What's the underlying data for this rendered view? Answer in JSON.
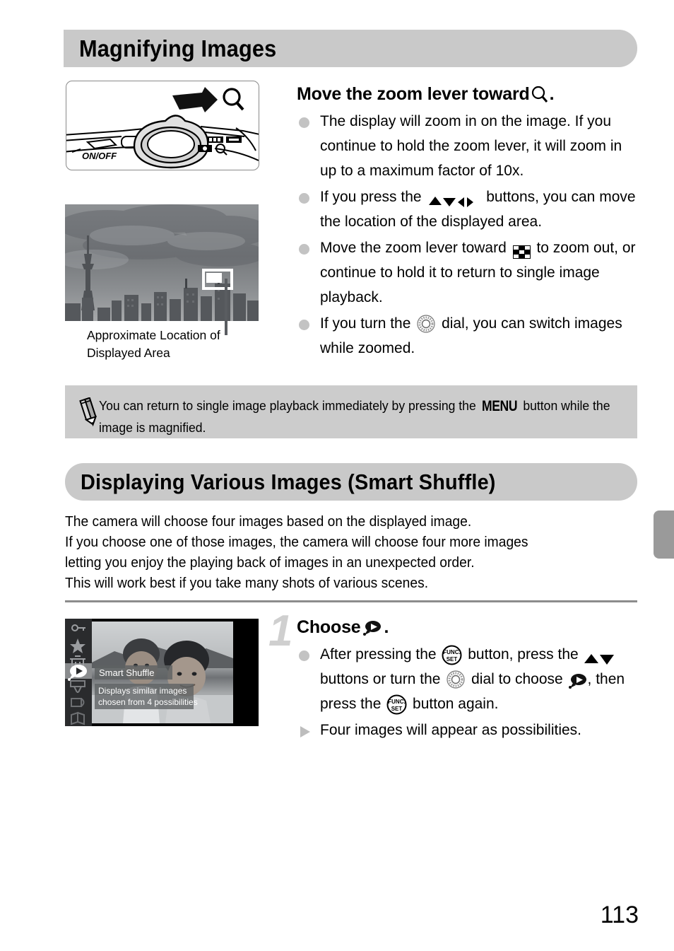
{
  "page": {
    "number": "113",
    "side_tab": "chapter-tab"
  },
  "section1": {
    "banner_title": "Magnifying Images",
    "figure_camera": {
      "name": "camera-top-zoom-lever-illustration",
      "on_off_label": "ON/OFF",
      "magnify_icon": "magnify-icon",
      "arrow_icon": "arrow-right-icon"
    },
    "figure_photo": {
      "name": "cityscape-photo",
      "indicator": "displayed-area-indicator"
    },
    "caption": "Approximate Location of Displayed Area",
    "heading": {
      "text_before": "Move the zoom lever toward ",
      "icon": "magnify-icon",
      "text_after": "."
    },
    "bullets": [
      {
        "parts": [
          {
            "type": "text",
            "value": "The display will zoom in on the image. If you continue to hold the zoom lever, it will zoom in up to a maximum factor of 10x."
          }
        ]
      },
      {
        "parts": [
          {
            "type": "text",
            "value": "If you press the "
          },
          {
            "type": "icon",
            "value": "updown-leftright-arrows-icon"
          },
          {
            "type": "text",
            "value": " buttons, you can move the location of the displayed area."
          }
        ]
      },
      {
        "parts": [
          {
            "type": "text",
            "value": "Move the zoom lever toward "
          },
          {
            "type": "icon",
            "value": "index-view-icon"
          },
          {
            "type": "text",
            "value": " to zoom out, or continue to hold it to return to single image playback."
          }
        ]
      },
      {
        "parts": [
          {
            "type": "text",
            "value": "If you turn the "
          },
          {
            "type": "icon",
            "value": "control-dial-icon"
          },
          {
            "type": "text",
            "value": " dial, you can switch images while zoomed."
          }
        ]
      }
    ],
    "note": {
      "icon": "pencil-icon",
      "text_before": "You can return to single image playback immediately by pressing the ",
      "menu_word": "MENU",
      "text_after": " button while the image is magnified."
    }
  },
  "section2": {
    "banner_title": "Displaying Various Images (Smart Shuffle)",
    "intro_lines": [
      "The camera will choose four images based on the displayed image.",
      "If you choose one of those images, the camera will choose four more images",
      "letting you enjoy the playing back of images in an unexpected order.",
      "This will work best if you take many shots of various scenes."
    ],
    "figure_lcd": {
      "name": "camera-lcd-func-menu",
      "menu_title": "Smart Shuffle",
      "menu_description_line1": "Displays similar images",
      "menu_description_line2": "chosen from 4 possibilities",
      "sidebar_icons": [
        "protect-key-icon",
        "favorites-star-icon",
        "erase-trash-icon",
        "smart-shuffle-icon",
        "filter-playback-icon",
        "rotate-icon",
        "photobook-icon"
      ],
      "selected_icon": "smart-shuffle-icon"
    },
    "step": {
      "number": "1",
      "heading_before": "Choose ",
      "heading_icon": "smart-shuffle-icon",
      "heading_after": ".",
      "bullets": [
        {
          "type": "dot",
          "parts": [
            {
              "type": "text",
              "value": "After pressing the "
            },
            {
              "type": "icon",
              "value": "func-set-button-icon"
            },
            {
              "type": "text",
              "value": " button, press the "
            },
            {
              "type": "icon",
              "value": "updown-arrows-icon"
            },
            {
              "type": "text",
              "value": " buttons or turn the "
            },
            {
              "type": "icon",
              "value": "control-dial-icon"
            },
            {
              "type": "text",
              "value": " dial to choose "
            },
            {
              "type": "icon",
              "value": "smart-shuffle-icon"
            },
            {
              "type": "text",
              "value": ", then press the "
            },
            {
              "type": "icon",
              "value": "func-set-button-icon"
            },
            {
              "type": "text",
              "value": " button again."
            }
          ]
        },
        {
          "type": "triangle",
          "parts": [
            {
              "type": "text",
              "value": "Four images will appear as possibilities."
            }
          ]
        }
      ]
    }
  }
}
